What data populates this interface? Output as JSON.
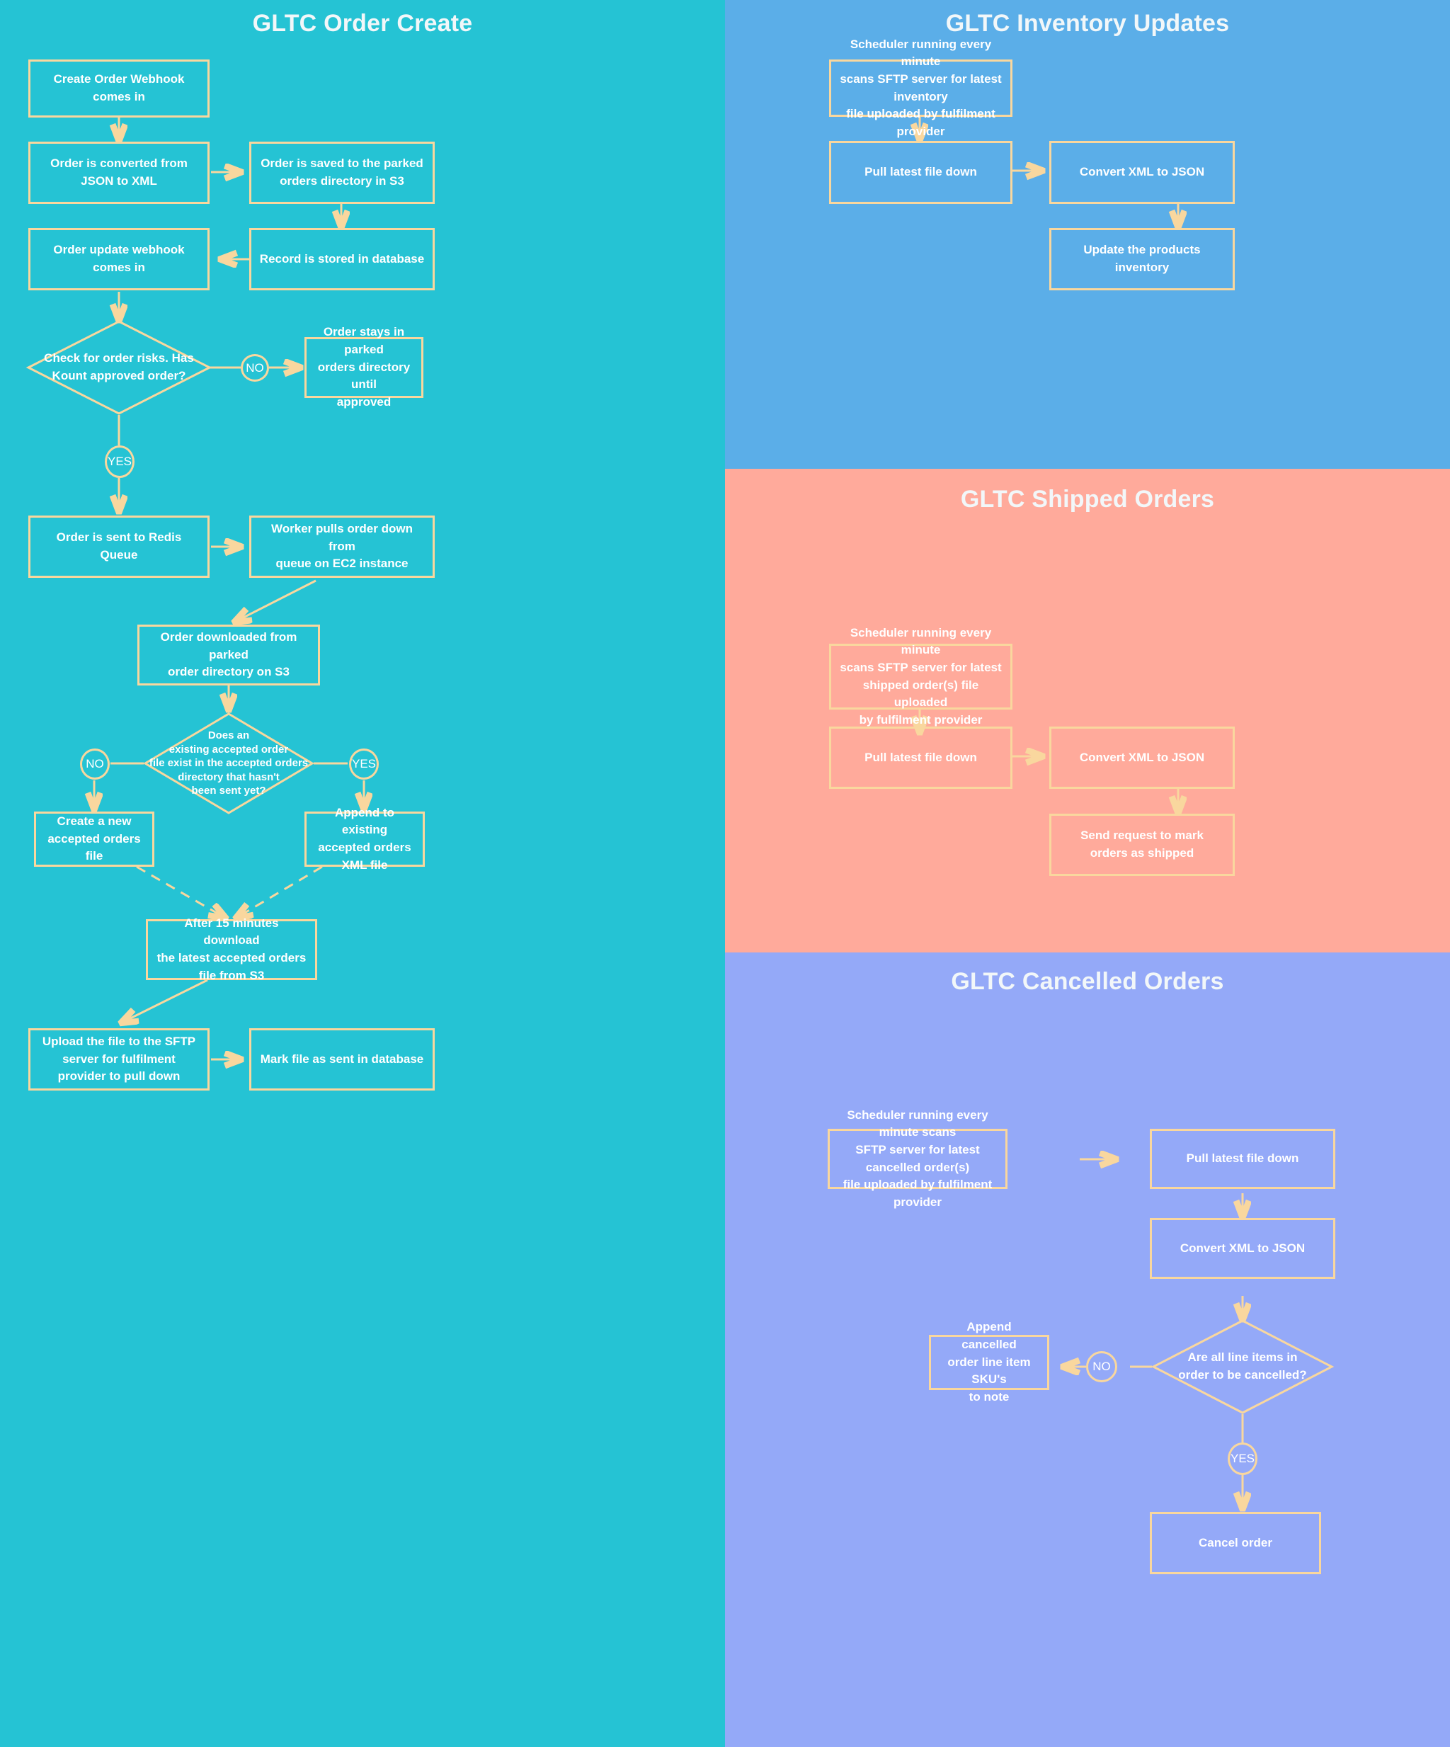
{
  "colors": {
    "teal": "#25C3D4",
    "blue": "#5BAEE8",
    "salmon": "#FFAA9B",
    "periwinkle": "#94A9F8",
    "stroke": "#F9D79E",
    "text": "#FFFFFF",
    "title": "#F2F7F9"
  },
  "panels": {
    "order_create": {
      "title": "GLTC Order Create",
      "nodes": {
        "webhook_in": "Create Order Webhook comes in",
        "convert_json_xml": "Order is converted from\nJSON to XML",
        "saved_parked": "Order is saved to the parked\norders directory in S3",
        "record_stored": "Record is stored in database",
        "update_webhook": "Order update webhook comes in",
        "risk_check": "Check for order risks. Has\nKount approved order?",
        "stays_parked": "Order stays in parked\norders directory until\napproved",
        "redis_queue": "Order is sent to Redis Queue",
        "worker_pulls": "Worker pulls order down from\nqueue on EC2 instance",
        "downloaded_parked": "Order downloaded from parked\norder directory on S3",
        "existing_file_check": "Does an\nexisting accepted order\nfile exist in the accepted orders\ndirectory that hasn't\nbeen sent yet?",
        "create_new_file": "Create a new\naccepted orders file",
        "append_existing": "Append to existing\naccepted orders\nXML file",
        "after_15_minutes": "After 15 minutes download\nthe latest accepted orders\nfile from S3",
        "upload_sftp": "Upload the file to the SFTP\nserver for fulfilment\nprovider to pull down",
        "mark_sent": "Mark file as sent in database"
      },
      "badges": {
        "risk_no": "NO",
        "risk_yes": "YES",
        "file_no": "NO",
        "file_yes": "YES"
      }
    },
    "inventory": {
      "title": "GLTC Inventory Updates",
      "nodes": {
        "scheduler": "Scheduler running every minute\nscans SFTP server for latest inventory\nfile uploaded by fulfilment provider",
        "pull_latest": "Pull latest file down",
        "convert_xml_json": "Convert XML to JSON",
        "update_inventory": "Update the products inventory"
      }
    },
    "shipped": {
      "title": "GLTC Shipped Orders",
      "nodes": {
        "scheduler": "Scheduler running every minute\nscans SFTP server for latest\nshipped order(s) file uploaded\nby fulfilment provider",
        "pull_latest": "Pull latest file down",
        "convert_xml_json": "Convert XML to JSON",
        "mark_shipped": "Send request to mark\norders as shipped"
      }
    },
    "cancelled": {
      "title": "GLTC Cancelled Orders",
      "nodes": {
        "scheduler": "Scheduler running every minute scans\nSFTP server for latest cancelled order(s)\nfile uploaded by fulfilment provider",
        "pull_latest": "Pull latest file down",
        "convert_xml_json": "Convert XML to JSON",
        "all_line_items": "Are all line items in\norder to be cancelled?",
        "append_sku": "Append cancelled\norder line item SKU's\nto note",
        "cancel_order": "Cancel order"
      },
      "badges": {
        "lines_no": "NO",
        "lines_yes": "YES"
      }
    }
  }
}
